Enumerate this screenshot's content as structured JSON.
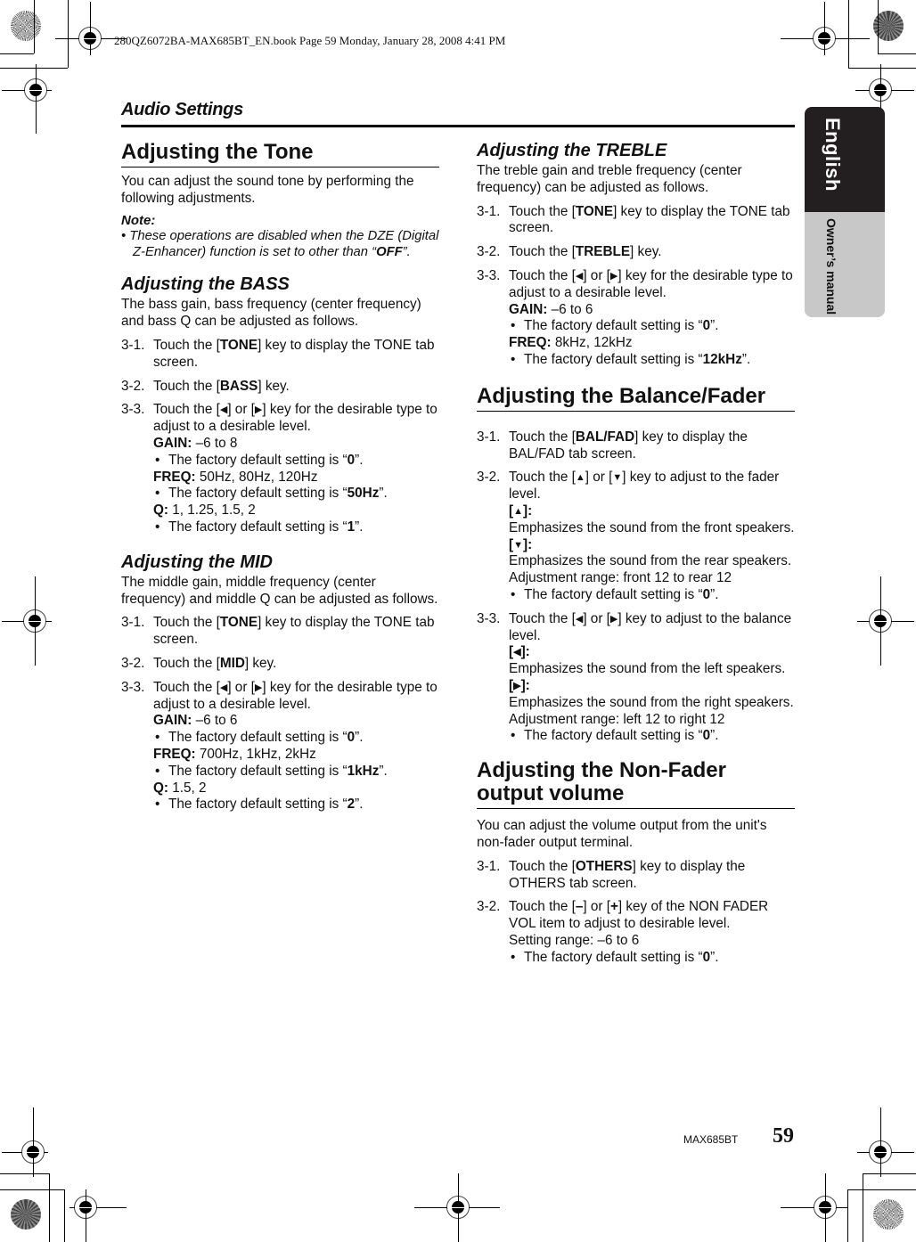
{
  "book_meta": "280QZ6072BA-MAX685BT_EN.book  Page 59  Monday, January 28, 2008  4:41 PM",
  "running_head": "Audio Settings",
  "side_tab": {
    "language": "English",
    "manual": "Owner’s manual"
  },
  "footer": {
    "model": "MAX685BT",
    "page_number": "59"
  },
  "icons": {
    "left": "◀",
    "right": "▶",
    "up": "▲",
    "down": "▼"
  },
  "left_column": {
    "tone": {
      "title": "Adjusting the Tone",
      "intro": "You can adjust the sound tone by performing the following adjustments.",
      "note_title": "Note:",
      "note_pre": "These operations are disabled when the DZE (Digital Z-Enhancer) function is set to other than “",
      "note_bold": "OFF",
      "note_post": "”."
    },
    "bass": {
      "title": "Adjusting the BASS",
      "intro": "The bass gain, bass frequency (center frequency) and bass Q can be adjusted as follows.",
      "steps": [
        {
          "num": "3-1.",
          "pre": "Touch the [",
          "key": "TONE",
          "post": "] key to display the TONE tab screen."
        },
        {
          "num": "3-2.",
          "pre": "Touch the [",
          "key": "BASS",
          "post": "] key."
        },
        {
          "num": "3-3.",
          "pre": "Touch the [",
          "mid": "] or [",
          "post": "] key for the desirable type to adjust to a desirable level."
        }
      ],
      "params": [
        {
          "label": "GAIN:",
          "value": " –6 to 8",
          "default_pre": "The factory default setting is “",
          "default": "0",
          "default_post": "”."
        },
        {
          "label": "FREQ:",
          "value": " 50Hz, 80Hz, 120Hz",
          "default_pre": "The factory default setting is “",
          "default": "50Hz",
          "default_post": "”."
        },
        {
          "label": "Q:",
          "value": " 1, 1.25, 1.5, 2",
          "default_pre": "The factory default setting is “",
          "default": "1",
          "default_post": "”."
        }
      ]
    },
    "mid": {
      "title": "Adjusting the MID",
      "intro": "The middle gain, middle frequency (center frequency) and middle Q can be adjusted as follows.",
      "steps": [
        {
          "num": "3-1.",
          "pre": "Touch the [",
          "key": "TONE",
          "post": "] key to display the TONE tab screen."
        },
        {
          "num": "3-2.",
          "pre": "Touch the [",
          "key": "MID",
          "post": "] key."
        },
        {
          "num": "3-3.",
          "pre": "Touch the [",
          "mid": "] or [",
          "post": "] key for the desirable type to adjust to a desirable level."
        }
      ],
      "params": [
        {
          "label": "GAIN:",
          "value": " –6 to 6",
          "default_pre": "The factory default setting is “",
          "default": "0",
          "default_post": "”."
        },
        {
          "label": "FREQ:",
          "value": " 700Hz, 1kHz, 2kHz",
          "default_pre": "The factory default setting is “",
          "default": "1kHz",
          "default_post": "”."
        },
        {
          "label": "Q:",
          "value": " 1.5, 2",
          "default_pre": "The factory default setting is “",
          "default": "2",
          "default_post": "”."
        }
      ]
    }
  },
  "right_column": {
    "treble": {
      "title": "Adjusting the TREBLE",
      "intro": "The treble gain and treble frequency (center frequency) can be adjusted as follows.",
      "steps": [
        {
          "num": "3-1.",
          "pre": "Touch the [",
          "key": "TONE",
          "post": "] key to display the TONE tab screen."
        },
        {
          "num": "3-2.",
          "pre": "Touch the [",
          "key": "TREBLE",
          "post": "] key."
        },
        {
          "num": "3-3.",
          "pre": "Touch the [",
          "mid": "] or [",
          "post": "] key for the desirable type to adjust to a desirable level."
        }
      ],
      "params": [
        {
          "label": "GAIN:",
          "value": " –6 to 6",
          "default_pre": "The factory default setting is “",
          "default": "0",
          "default_post": "”."
        },
        {
          "label": "FREQ:",
          "value": " 8kHz, 12kHz",
          "default_pre": "The factory default setting is “",
          "default": "12kHz",
          "default_post": "”."
        }
      ]
    },
    "balance": {
      "title": "Adjusting the Balance/Fader",
      "step1": {
        "num": "3-1.",
        "pre": "Touch the [",
        "key": "BAL/FAD",
        "post": "] key to display the BAL/FAD tab screen."
      },
      "step2": {
        "num": "3-2.",
        "pre": "Touch the [",
        "mid": "] or [",
        "post": "] key to adjust to the fader level.",
        "up_desc": "Emphasizes the sound from the front speakers.",
        "down_desc": "Emphasizes the sound from the rear speakers.",
        "range": "Adjustment range: front 12 to rear 12",
        "default_pre": "The factory default setting is “",
        "default": "0",
        "default_post": "”."
      },
      "step3": {
        "num": "3-3.",
        "pre": "Touch the [",
        "mid": "] or [",
        "post": "] key to adjust to the balance level.",
        "left_desc": "Emphasizes the sound from the left speakers.",
        "right_desc": "Emphasizes the sound from the right speakers.",
        "range": "Adjustment range: left 12 to right 12",
        "default_pre": "The factory default setting is “",
        "default": "0",
        "default_post": "”."
      }
    },
    "nonfader": {
      "title": "Adjusting the Non-Fader output volume",
      "intro": "You can adjust the volume output from the unit's non-fader output terminal.",
      "step1": {
        "num": "3-1.",
        "pre": "Touch the [",
        "key": "OTHERS",
        "post": "] key to display the OTHERS tab screen."
      },
      "step2": {
        "num": "3-2.",
        "pre": "Touch the [",
        "minus": "–",
        "mid": "] or [",
        "plus": "+",
        "post": "] key of the NON FADER VOL item to adjust to desirable level.",
        "range": "Setting range: –6 to 6",
        "default_pre": "The factory default setting is “",
        "default": "0",
        "default_post": "”."
      }
    }
  }
}
